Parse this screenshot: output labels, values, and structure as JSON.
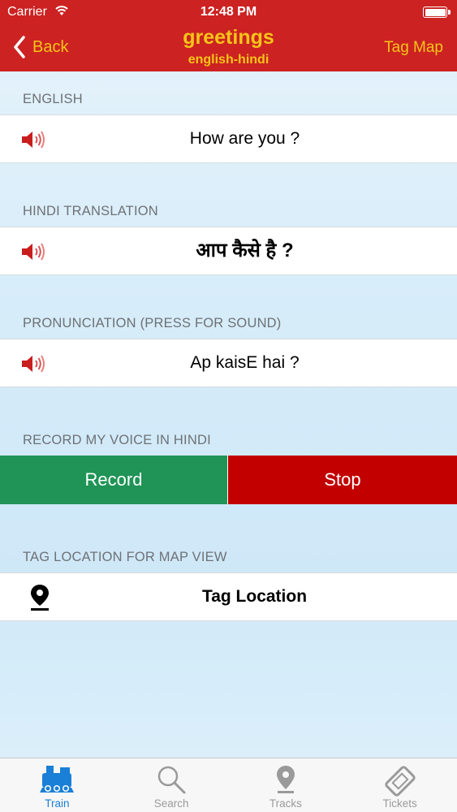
{
  "status_bar": {
    "carrier": "Carrier",
    "time": "12:48 PM"
  },
  "nav": {
    "back_label": "Back",
    "title": "greetings",
    "subtitle": "english-hindi",
    "right_label": "Tag Map"
  },
  "sections": {
    "english": {
      "header": "ENGLISH",
      "text": "How are you ?"
    },
    "hindi": {
      "header": "HINDI TRANSLATION",
      "text": "आप कैसे है ?"
    },
    "pronunciation": {
      "header": "PRONUNCIATION (PRESS FOR SOUND)",
      "text": "Ap kaisE hai ?"
    },
    "record": {
      "header": "RECORD MY VOICE IN HINDI",
      "record_label": "Record",
      "stop_label": "Stop"
    },
    "location": {
      "header": "TAG LOCATION FOR MAP VIEW",
      "text": "Tag Location"
    }
  },
  "tabs": [
    {
      "label": "Train",
      "icon": "train-icon",
      "active": true
    },
    {
      "label": "Search",
      "icon": "search-icon",
      "active": false
    },
    {
      "label": "Tracks",
      "icon": "map-pin-icon",
      "active": false
    },
    {
      "label": "Tickets",
      "icon": "ticket-icon",
      "active": false
    }
  ],
  "colors": {
    "nav_bg": "#cc2222",
    "nav_text": "#f5c518",
    "record_bg": "#1f9456",
    "stop_bg": "#c20000",
    "tab_active": "#1a7fd6"
  }
}
